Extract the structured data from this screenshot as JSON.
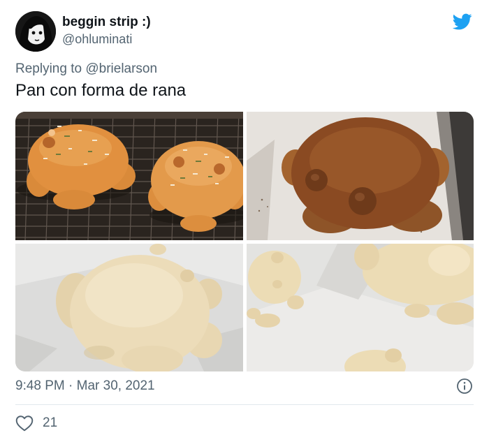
{
  "author": {
    "display_name": "beggin strip :)",
    "handle": "@ohluminati"
  },
  "reply": {
    "prefix": "Replying to ",
    "mention": "@brielarson"
  },
  "tweet": {
    "text": "Pan con forma de rana",
    "timestamp": "9:48 PM · Mar 30, 2021",
    "likes": "21"
  },
  "icons": {
    "brand": "twitter-bird-icon",
    "info": "info-icon",
    "like": "heart-outline-icon"
  },
  "colors": {
    "brand_blue": "#1da1f2",
    "muted_text": "#536471",
    "primary_text": "#0f1419",
    "divider": "#e1e8ed"
  },
  "media": [
    {
      "name": "photo-1-baked-frog-breads-on-rack"
    },
    {
      "name": "photo-2-dark-baked-frog-bread"
    },
    {
      "name": "photo-3-raw-dough-frog"
    },
    {
      "name": "photo-4-raw-dough-frogs-on-paper"
    }
  ]
}
